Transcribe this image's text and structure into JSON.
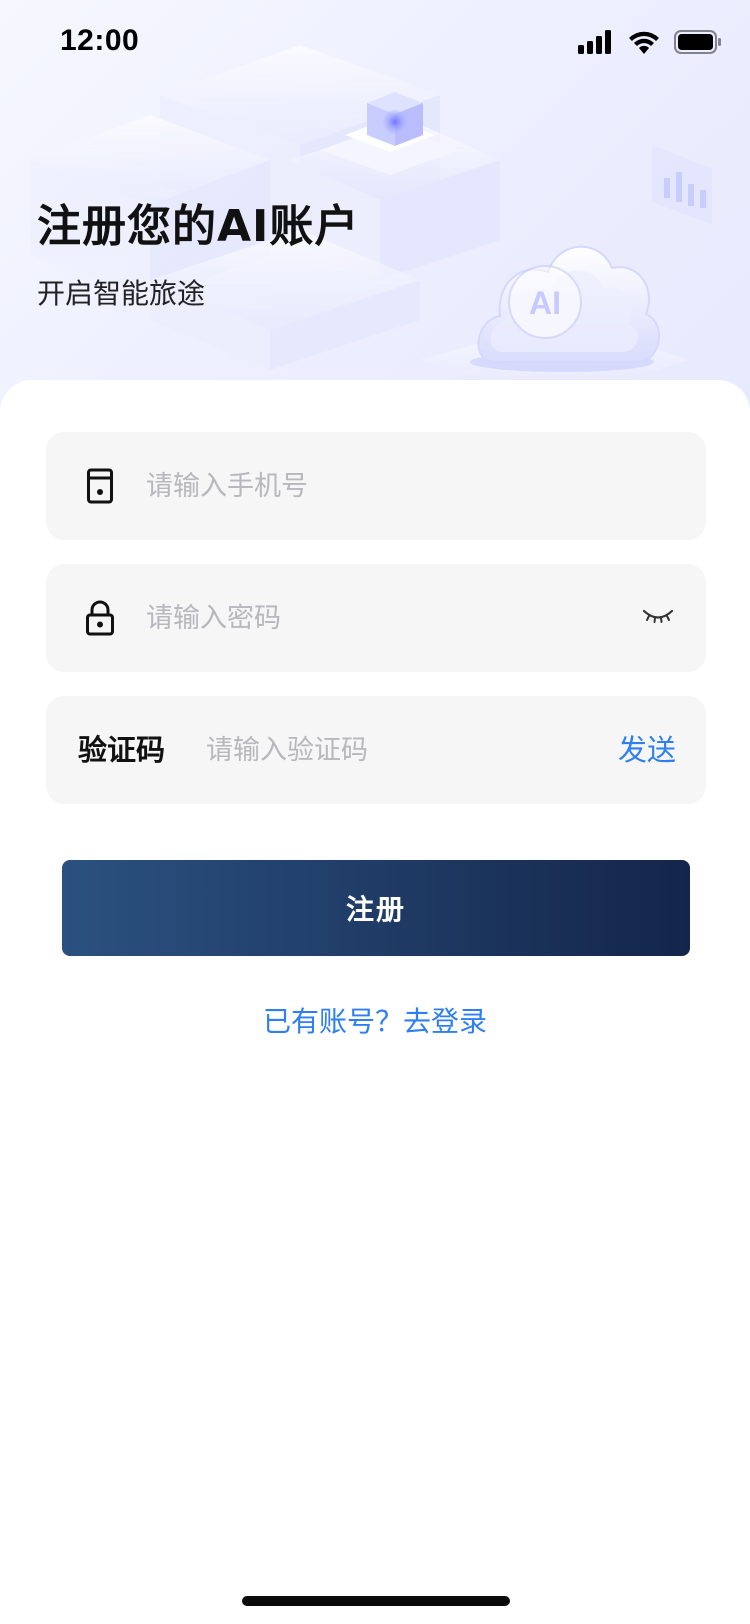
{
  "status_bar": {
    "time": "12:00"
  },
  "hero": {
    "title": "注册您的AI账户",
    "subtitle": "开启智能旅途",
    "illustration_badge": "AI"
  },
  "form": {
    "phone": {
      "icon": "phone-icon",
      "value": "",
      "placeholder": "请输入手机号"
    },
    "password": {
      "icon": "lock-icon",
      "value": "",
      "placeholder": "请输入密码",
      "toggle_icon": "eye-closed-icon"
    },
    "code": {
      "label": "验证码",
      "value": "",
      "placeholder": "请输入验证码",
      "send_label": "发送"
    },
    "submit_label": "注册",
    "login_link": "已有账号？去登录"
  },
  "colors": {
    "accent": "#2d7ff3",
    "button_gradient_start": "#2b5180",
    "button_gradient_end": "#14254a",
    "field_background": "#f6f6f6"
  }
}
